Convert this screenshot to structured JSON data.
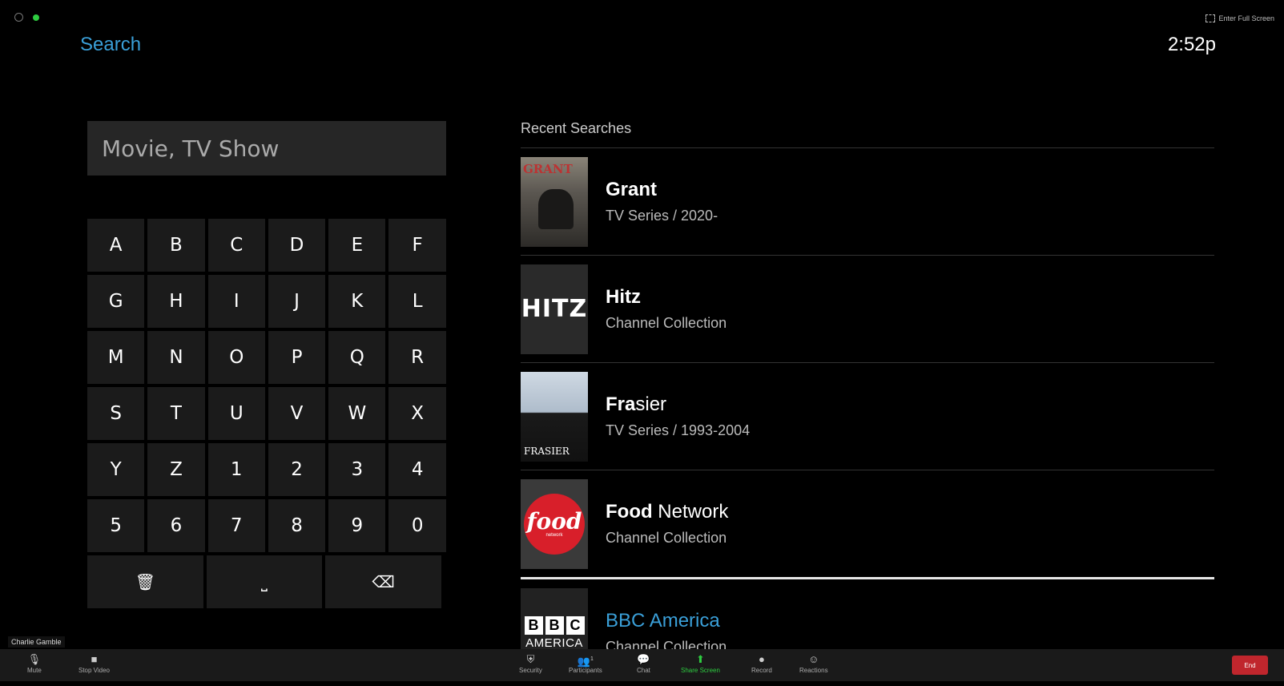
{
  "window": {
    "fullscreen_label": "Enter Full Screen"
  },
  "header": {
    "title": "Search",
    "clock": "2:52p"
  },
  "search": {
    "placeholder": "Movie, TV Show",
    "value": ""
  },
  "keyboard": {
    "rows": [
      [
        "A",
        "B",
        "C",
        "D",
        "E",
        "F"
      ],
      [
        "G",
        "H",
        "I",
        "J",
        "K",
        "L"
      ],
      [
        "M",
        "N",
        "O",
        "P",
        "Q",
        "R"
      ],
      [
        "S",
        "T",
        "U",
        "V",
        "W",
        "X"
      ],
      [
        "Y",
        "Z",
        "1",
        "2",
        "3",
        "4"
      ],
      [
        "5",
        "6",
        "7",
        "8",
        "9",
        "0"
      ]
    ],
    "actions": [
      {
        "name": "clear-button",
        "icon": "trash-icon",
        "glyph": "🗑"
      },
      {
        "name": "space-button",
        "icon": "space-icon",
        "glyph": "⎵"
      },
      {
        "name": "backspace-button",
        "icon": "backspace-icon",
        "glyph": "⌫"
      }
    ]
  },
  "recent": {
    "title": "Recent Searches",
    "items": [
      {
        "name_bold": "Grant",
        "name_rest": "",
        "subtitle": "TV Series / 2020-",
        "thumb_text": "GRANT"
      },
      {
        "name_bold": "Hitz",
        "name_rest": "",
        "subtitle": "Channel Collection",
        "thumb_text": "HITZ"
      },
      {
        "name_bold": "Fra",
        "name_rest": "sier",
        "subtitle": "TV Series / 1993-2004",
        "thumb_text": "FRASIER"
      },
      {
        "name_bold": "Food",
        "name_rest": " Network",
        "subtitle": "Channel Collection",
        "thumb_text": "food",
        "thumb_sub": "network"
      },
      {
        "name_bold": "",
        "name_rest": "BBC America",
        "subtitle": "Channel Collection",
        "thumb_text": "AMERICA",
        "thumb_letters": [
          "B",
          "B",
          "C"
        ]
      }
    ]
  },
  "zoom": {
    "participant_name": "Charlie Gamble",
    "toolbar": {
      "mute": "Mute",
      "stop_video": "Stop Video",
      "security": "Security",
      "participants": "Participants",
      "participant_count": "1",
      "chat": "Chat",
      "share_screen": "Share Screen",
      "record": "Record",
      "reactions": "Reactions",
      "end": "End"
    },
    "colors": {
      "share": "#2ecc40",
      "end": "#c0262d"
    }
  },
  "colors": {
    "accent": "#3a9fd8",
    "background": "#000000"
  }
}
